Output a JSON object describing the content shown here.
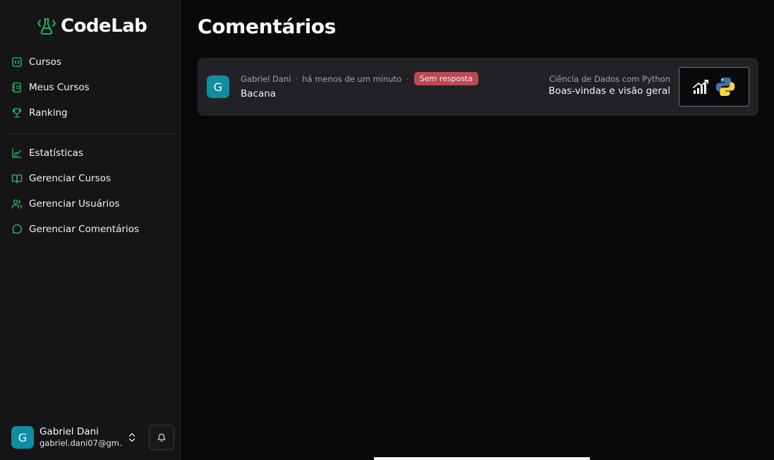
{
  "brand": {
    "name": "CodeLab",
    "accent": "#22c55e"
  },
  "sidebar": {
    "primary_items": [
      {
        "label": "Cursos",
        "icon": "code-square-icon"
      },
      {
        "label": "Meus Cursos",
        "icon": "notebook-icon"
      },
      {
        "label": "Ranking",
        "icon": "trophy-icon"
      }
    ],
    "admin_items": [
      {
        "label": "Estatísticas",
        "icon": "chart-icon"
      },
      {
        "label": "Gerenciar Cursos",
        "icon": "book-open-icon"
      },
      {
        "label": "Gerenciar Usuários",
        "icon": "users-icon"
      },
      {
        "label": "Gerenciar Comentários",
        "icon": "message-circle-icon"
      }
    ],
    "user": {
      "initial": "G",
      "name": "Gabriel Dani",
      "email": "gabriel.dani07@gm..."
    }
  },
  "page": {
    "title": "Comentários"
  },
  "comments": [
    {
      "author_initial": "G",
      "author": "Gabriel Dani",
      "time": "há menos de um minuto",
      "status": "Sem resposta",
      "text": "Bacana",
      "course": "Ciência de Dados com Python",
      "lesson": "Boas-vindas e visão geral",
      "thumbnail_icons": [
        "growth-chart-icon",
        "python-logo-icon"
      ]
    }
  ],
  "colors": {
    "badge": "#b94a54",
    "avatar": "#0f8ea1",
    "sidebar_bg": "#151517",
    "main_bg": "#09090b"
  }
}
